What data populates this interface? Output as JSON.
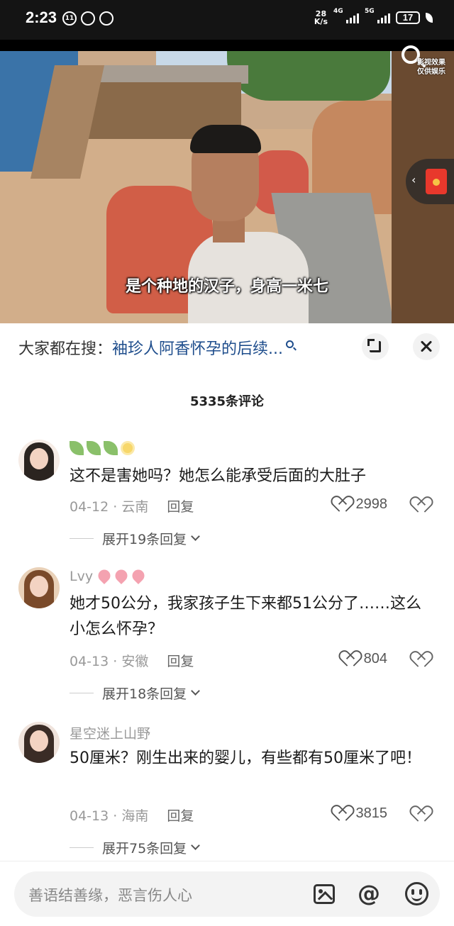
{
  "status_bar": {
    "time": "2:23",
    "net_speed_value": "28",
    "net_speed_unit": "K/s",
    "network_1": "4G",
    "network_2": "5G",
    "battery": "17",
    "left_icon_badge": "11"
  },
  "video": {
    "subtitle": "是个种地的汉子，身高一米七",
    "overlay_text_line1": "影视效果",
    "overlay_text_line2": "仅供娱乐"
  },
  "search_bar": {
    "prefix": "大家都在搜：",
    "query": "袖珍人阿香怀孕的后续..."
  },
  "comments_header": "5335条评论",
  "comments": [
    {
      "username": "",
      "username_emojis": [
        "leaf-emoji",
        "leaf-emoji",
        "leaf-emoji",
        "flower-emoji"
      ],
      "text": "这不是害她吗？她怎么能承受后面的大肚子",
      "date": "04-12",
      "location": "云南",
      "reply_label": "回复",
      "likes": "2998",
      "expand_label": "展开19条回复"
    },
    {
      "username": "Lvy",
      "username_emojis": [
        "heart-emoji",
        "heart-emoji",
        "heart-emoji"
      ],
      "text": "她才50公分，我家孩子生下来都51公分了……这么小怎么怀孕？",
      "date": "04-13",
      "location": "安徽",
      "reply_label": "回复",
      "likes": "804",
      "expand_label": "展开18条回复"
    },
    {
      "username": "星空迷上山野",
      "username_emojis": [],
      "text": "50厘米？刚生出来的婴儿，有些都有50厘米了吧！",
      "date": "04-13",
      "location": "海南",
      "reply_label": "回复",
      "likes": "3815",
      "expand_label": "展开75条回复"
    }
  ],
  "input": {
    "placeholder": "善语结善缘，恶言伤人心",
    "at_symbol": "@"
  },
  "colors": {
    "search_query": "#1e4d8c",
    "status_bar_bg": "#141414",
    "meta_gray": "#999999"
  }
}
